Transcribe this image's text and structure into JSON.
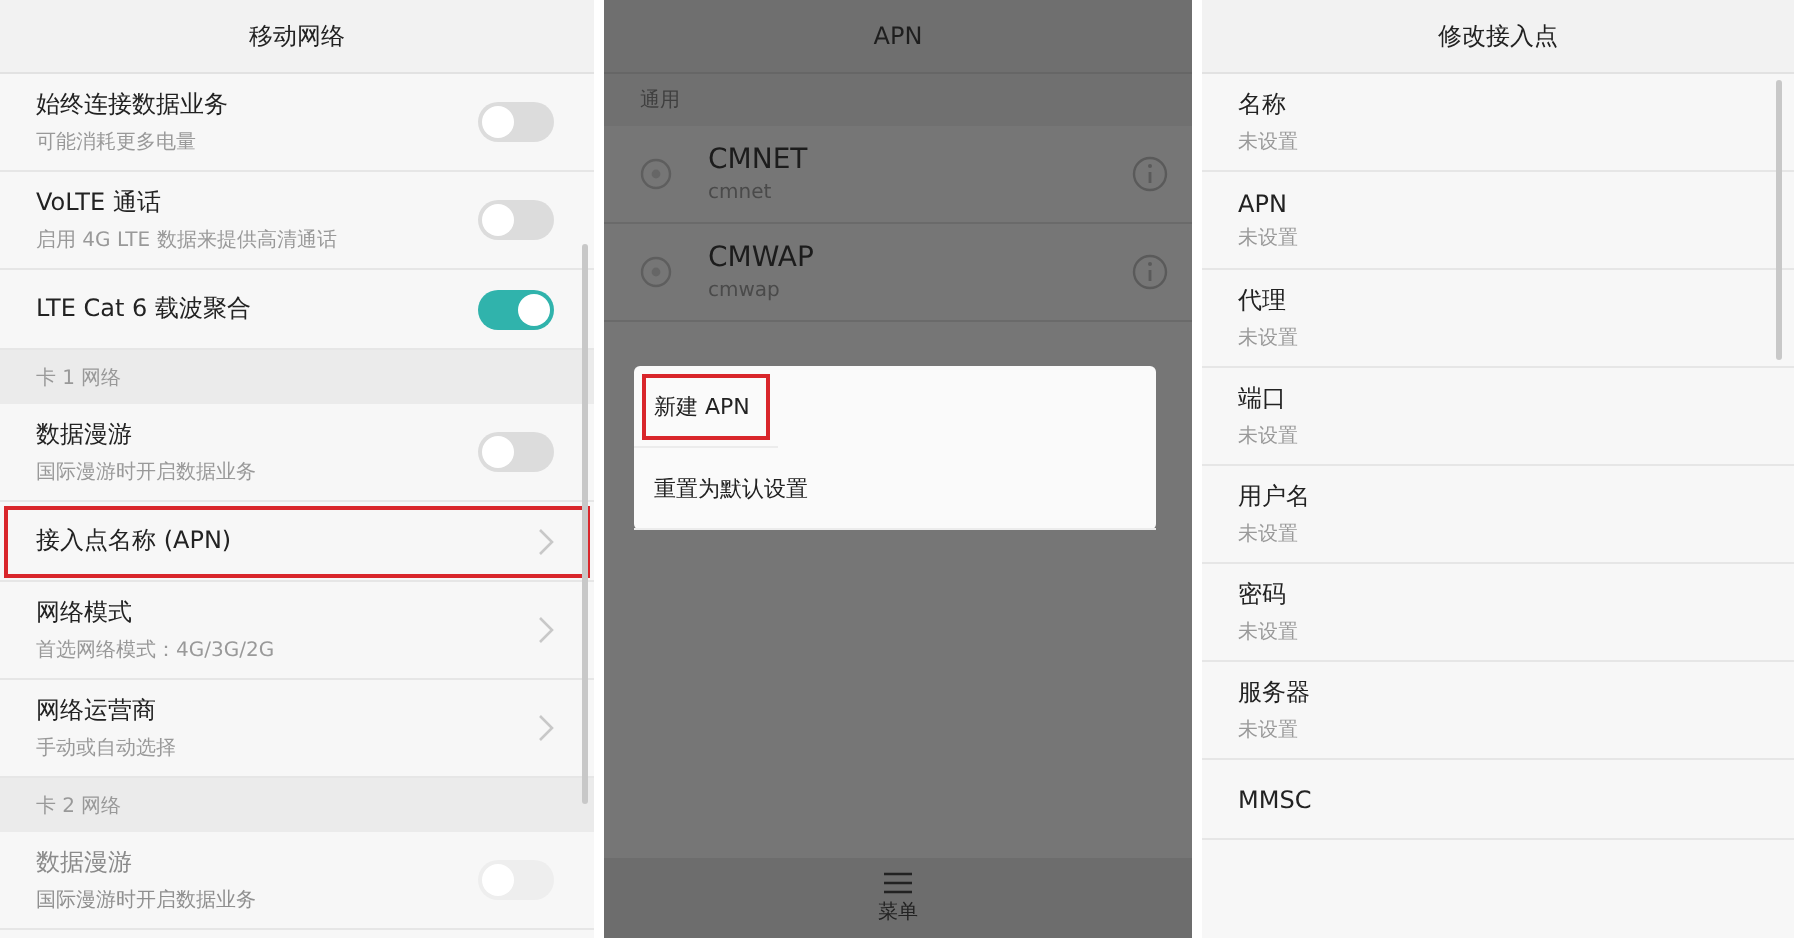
{
  "panels": [
    {
      "kind": "settings",
      "title": "移动网络",
      "dimmed": false,
      "items": [
        {
          "kind": "toggle",
          "label": "始终连接数据业务",
          "sub": "可能消耗更多电量",
          "on": false,
          "highlighted": false,
          "disabled": false
        },
        {
          "kind": "toggle",
          "label": "VoLTE 通话",
          "sub": "启用 4G LTE 数据来提供高清通话",
          "on": false,
          "highlighted": false,
          "disabled": false
        },
        {
          "kind": "toggle",
          "label": "LTE Cat 6 载波聚合",
          "on": true,
          "highlighted": false,
          "disabled": false
        },
        {
          "kind": "section",
          "label": "卡 1 网络"
        },
        {
          "kind": "toggle",
          "label": "数据漫游",
          "sub": "国际漫游时开启数据业务",
          "on": false,
          "highlighted": false,
          "disabled": false
        },
        {
          "kind": "link",
          "label": "接入点名称 (APN)",
          "highlighted": true,
          "disabled": false
        },
        {
          "kind": "link",
          "label": "网络模式",
          "sub": "首选网络模式：4G/3G/2G",
          "highlighted": false,
          "disabled": false
        },
        {
          "kind": "link",
          "label": "网络运营商",
          "sub": "手动或自动选择",
          "highlighted": false,
          "disabled": false
        },
        {
          "kind": "section",
          "label": "卡 2 网络"
        },
        {
          "kind": "toggle",
          "label": "数据漫游",
          "sub": "国际漫游时开启数据业务",
          "on": false,
          "highlighted": false,
          "disabled": true
        }
      ]
    },
    {
      "kind": "apn_list",
      "title": "APN",
      "dimmed": true,
      "items": [
        {
          "kind": "section",
          "label": "通用"
        },
        {
          "kind": "radio",
          "label": "CMNET",
          "sub": "cmnet",
          "selected": false
        },
        {
          "kind": "radio",
          "label": "CMWAP",
          "sub": "cmwap",
          "selected": false
        }
      ],
      "dialog": {
        "items": [
          {
            "label": "新建 APN",
            "highlighted": true
          },
          {
            "label": "重置为默认设置",
            "highlighted": false
          }
        ]
      },
      "bottom_bar": {
        "label": "菜单"
      }
    },
    {
      "kind": "edit_form",
      "title": "修改接入点",
      "dimmed": false,
      "items": [
        {
          "kind": "field",
          "label": "名称",
          "sub": "未设置"
        },
        {
          "kind": "field",
          "label": "APN",
          "sub": "未设置"
        },
        {
          "kind": "field",
          "label": "代理",
          "sub": "未设置"
        },
        {
          "kind": "field",
          "label": "端口",
          "sub": "未设置"
        },
        {
          "kind": "field",
          "label": "用户名",
          "sub": "未设置"
        },
        {
          "kind": "field",
          "label": "密码",
          "sub": "未设置"
        },
        {
          "kind": "field",
          "label": "服务器",
          "sub": "未设置"
        },
        {
          "kind": "field",
          "label": "MMSC"
        }
      ]
    }
  ]
}
